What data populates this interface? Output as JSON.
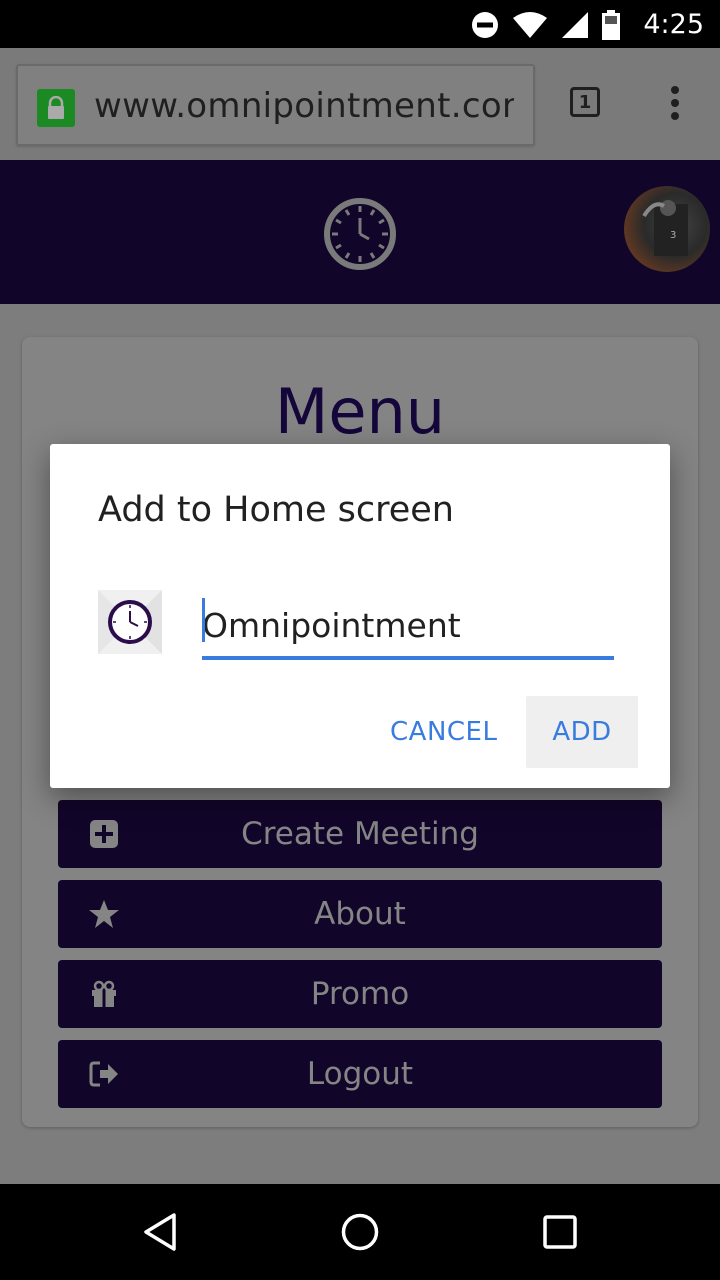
{
  "status_bar": {
    "time": "4:25",
    "icons": [
      "do-not-disturb-icon",
      "wifi-icon",
      "signal-icon",
      "battery-icon"
    ]
  },
  "browser": {
    "url": "www.omnipointment.com/r",
    "tab_count": "1",
    "icons": [
      "lock-icon",
      "overflow-menu-icon"
    ]
  },
  "header": {
    "logo_icon": "clock-icon",
    "avatar_icon": "avatar"
  },
  "menu": {
    "title": "Menu",
    "items": [
      {
        "label": "Create Meeting",
        "icon": "plus-square-icon"
      },
      {
        "label": "About",
        "icon": "star-icon"
      },
      {
        "label": "Promo",
        "icon": "gift-icon"
      },
      {
        "label": "Logout",
        "icon": "sign-out-icon"
      }
    ]
  },
  "dialog": {
    "title": "Add to Home screen",
    "app_name_value": "Omnipointment",
    "cancel_label": "CANCEL",
    "add_label": "ADD"
  },
  "navbar": {
    "icons": [
      "back-icon",
      "home-icon",
      "recents-icon"
    ]
  },
  "colors": {
    "header_bg": "#12052a",
    "accent": "#3a7be0",
    "lock_green": "#1b8a22"
  }
}
